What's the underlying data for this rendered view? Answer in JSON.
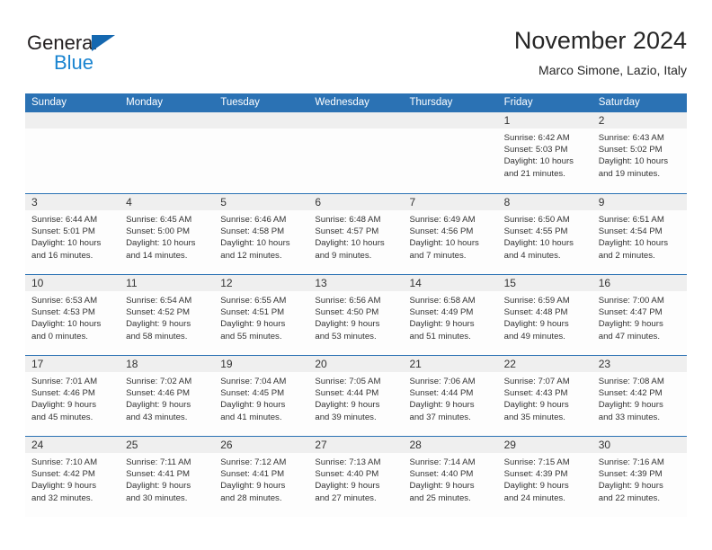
{
  "brand": {
    "name_part1": "General",
    "name_part2": "Blue",
    "triangle_color": "#1568b0",
    "blue_text_color": "#1a84d0"
  },
  "header": {
    "title": "November 2024",
    "subtitle": "Marco Simone, Lazio, Italy"
  },
  "theme": {
    "header_blue": "#2b72b4",
    "day_band_gray": "#efefef",
    "text_color": "#333333"
  },
  "weekdays": [
    "Sunday",
    "Monday",
    "Tuesday",
    "Wednesday",
    "Thursday",
    "Friday",
    "Saturday"
  ],
  "weeks": [
    [
      {
        "day": "",
        "lines": []
      },
      {
        "day": "",
        "lines": []
      },
      {
        "day": "",
        "lines": []
      },
      {
        "day": "",
        "lines": []
      },
      {
        "day": "",
        "lines": []
      },
      {
        "day": "1",
        "lines": [
          "Sunrise: 6:42 AM",
          "Sunset: 5:03 PM",
          "Daylight: 10 hours",
          "and 21 minutes."
        ]
      },
      {
        "day": "2",
        "lines": [
          "Sunrise: 6:43 AM",
          "Sunset: 5:02 PM",
          "Daylight: 10 hours",
          "and 19 minutes."
        ]
      }
    ],
    [
      {
        "day": "3",
        "lines": [
          "Sunrise: 6:44 AM",
          "Sunset: 5:01 PM",
          "Daylight: 10 hours",
          "and 16 minutes."
        ]
      },
      {
        "day": "4",
        "lines": [
          "Sunrise: 6:45 AM",
          "Sunset: 5:00 PM",
          "Daylight: 10 hours",
          "and 14 minutes."
        ]
      },
      {
        "day": "5",
        "lines": [
          "Sunrise: 6:46 AM",
          "Sunset: 4:58 PM",
          "Daylight: 10 hours",
          "and 12 minutes."
        ]
      },
      {
        "day": "6",
        "lines": [
          "Sunrise: 6:48 AM",
          "Sunset: 4:57 PM",
          "Daylight: 10 hours",
          "and 9 minutes."
        ]
      },
      {
        "day": "7",
        "lines": [
          "Sunrise: 6:49 AM",
          "Sunset: 4:56 PM",
          "Daylight: 10 hours",
          "and 7 minutes."
        ]
      },
      {
        "day": "8",
        "lines": [
          "Sunrise: 6:50 AM",
          "Sunset: 4:55 PM",
          "Daylight: 10 hours",
          "and 4 minutes."
        ]
      },
      {
        "day": "9",
        "lines": [
          "Sunrise: 6:51 AM",
          "Sunset: 4:54 PM",
          "Daylight: 10 hours",
          "and 2 minutes."
        ]
      }
    ],
    [
      {
        "day": "10",
        "lines": [
          "Sunrise: 6:53 AM",
          "Sunset: 4:53 PM",
          "Daylight: 10 hours",
          "and 0 minutes."
        ]
      },
      {
        "day": "11",
        "lines": [
          "Sunrise: 6:54 AM",
          "Sunset: 4:52 PM",
          "Daylight: 9 hours",
          "and 58 minutes."
        ]
      },
      {
        "day": "12",
        "lines": [
          "Sunrise: 6:55 AM",
          "Sunset: 4:51 PM",
          "Daylight: 9 hours",
          "and 55 minutes."
        ]
      },
      {
        "day": "13",
        "lines": [
          "Sunrise: 6:56 AM",
          "Sunset: 4:50 PM",
          "Daylight: 9 hours",
          "and 53 minutes."
        ]
      },
      {
        "day": "14",
        "lines": [
          "Sunrise: 6:58 AM",
          "Sunset: 4:49 PM",
          "Daylight: 9 hours",
          "and 51 minutes."
        ]
      },
      {
        "day": "15",
        "lines": [
          "Sunrise: 6:59 AM",
          "Sunset: 4:48 PM",
          "Daylight: 9 hours",
          "and 49 minutes."
        ]
      },
      {
        "day": "16",
        "lines": [
          "Sunrise: 7:00 AM",
          "Sunset: 4:47 PM",
          "Daylight: 9 hours",
          "and 47 minutes."
        ]
      }
    ],
    [
      {
        "day": "17",
        "lines": [
          "Sunrise: 7:01 AM",
          "Sunset: 4:46 PM",
          "Daylight: 9 hours",
          "and 45 minutes."
        ]
      },
      {
        "day": "18",
        "lines": [
          "Sunrise: 7:02 AM",
          "Sunset: 4:46 PM",
          "Daylight: 9 hours",
          "and 43 minutes."
        ]
      },
      {
        "day": "19",
        "lines": [
          "Sunrise: 7:04 AM",
          "Sunset: 4:45 PM",
          "Daylight: 9 hours",
          "and 41 minutes."
        ]
      },
      {
        "day": "20",
        "lines": [
          "Sunrise: 7:05 AM",
          "Sunset: 4:44 PM",
          "Daylight: 9 hours",
          "and 39 minutes."
        ]
      },
      {
        "day": "21",
        "lines": [
          "Sunrise: 7:06 AM",
          "Sunset: 4:44 PM",
          "Daylight: 9 hours",
          "and 37 minutes."
        ]
      },
      {
        "day": "22",
        "lines": [
          "Sunrise: 7:07 AM",
          "Sunset: 4:43 PM",
          "Daylight: 9 hours",
          "and 35 minutes."
        ]
      },
      {
        "day": "23",
        "lines": [
          "Sunrise: 7:08 AM",
          "Sunset: 4:42 PM",
          "Daylight: 9 hours",
          "and 33 minutes."
        ]
      }
    ],
    [
      {
        "day": "24",
        "lines": [
          "Sunrise: 7:10 AM",
          "Sunset: 4:42 PM",
          "Daylight: 9 hours",
          "and 32 minutes."
        ]
      },
      {
        "day": "25",
        "lines": [
          "Sunrise: 7:11 AM",
          "Sunset: 4:41 PM",
          "Daylight: 9 hours",
          "and 30 minutes."
        ]
      },
      {
        "day": "26",
        "lines": [
          "Sunrise: 7:12 AM",
          "Sunset: 4:41 PM",
          "Daylight: 9 hours",
          "and 28 minutes."
        ]
      },
      {
        "day": "27",
        "lines": [
          "Sunrise: 7:13 AM",
          "Sunset: 4:40 PM",
          "Daylight: 9 hours",
          "and 27 minutes."
        ]
      },
      {
        "day": "28",
        "lines": [
          "Sunrise: 7:14 AM",
          "Sunset: 4:40 PM",
          "Daylight: 9 hours",
          "and 25 minutes."
        ]
      },
      {
        "day": "29",
        "lines": [
          "Sunrise: 7:15 AM",
          "Sunset: 4:39 PM",
          "Daylight: 9 hours",
          "and 24 minutes."
        ]
      },
      {
        "day": "30",
        "lines": [
          "Sunrise: 7:16 AM",
          "Sunset: 4:39 PM",
          "Daylight: 9 hours",
          "and 22 minutes."
        ]
      }
    ]
  ]
}
